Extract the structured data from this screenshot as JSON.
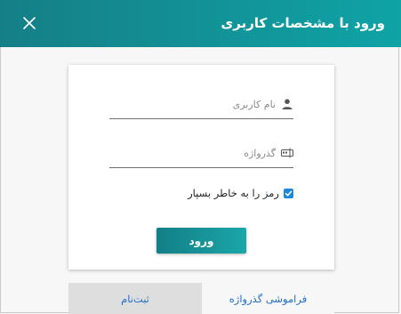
{
  "dialog": {
    "title": "ورود با مشخصات کاربری",
    "colors": {
      "header_start": "#157f86",
      "header_end": "#0fa3a6",
      "link": "#1e6fc7",
      "checkbox": "#1e87d8"
    }
  },
  "form": {
    "username": {
      "value": "",
      "placeholder": "نام کاربری",
      "icon": "user-icon"
    },
    "password": {
      "value": "",
      "placeholder": "گذرواژه",
      "icon": "password-icon"
    },
    "remember": {
      "label": "رمز را به خاطر بسپار",
      "checked": true
    },
    "submit_label": "ورود"
  },
  "footer": {
    "register_label": "ثبت‌نام",
    "forgot_label": "فراموشی گذرواژه"
  }
}
